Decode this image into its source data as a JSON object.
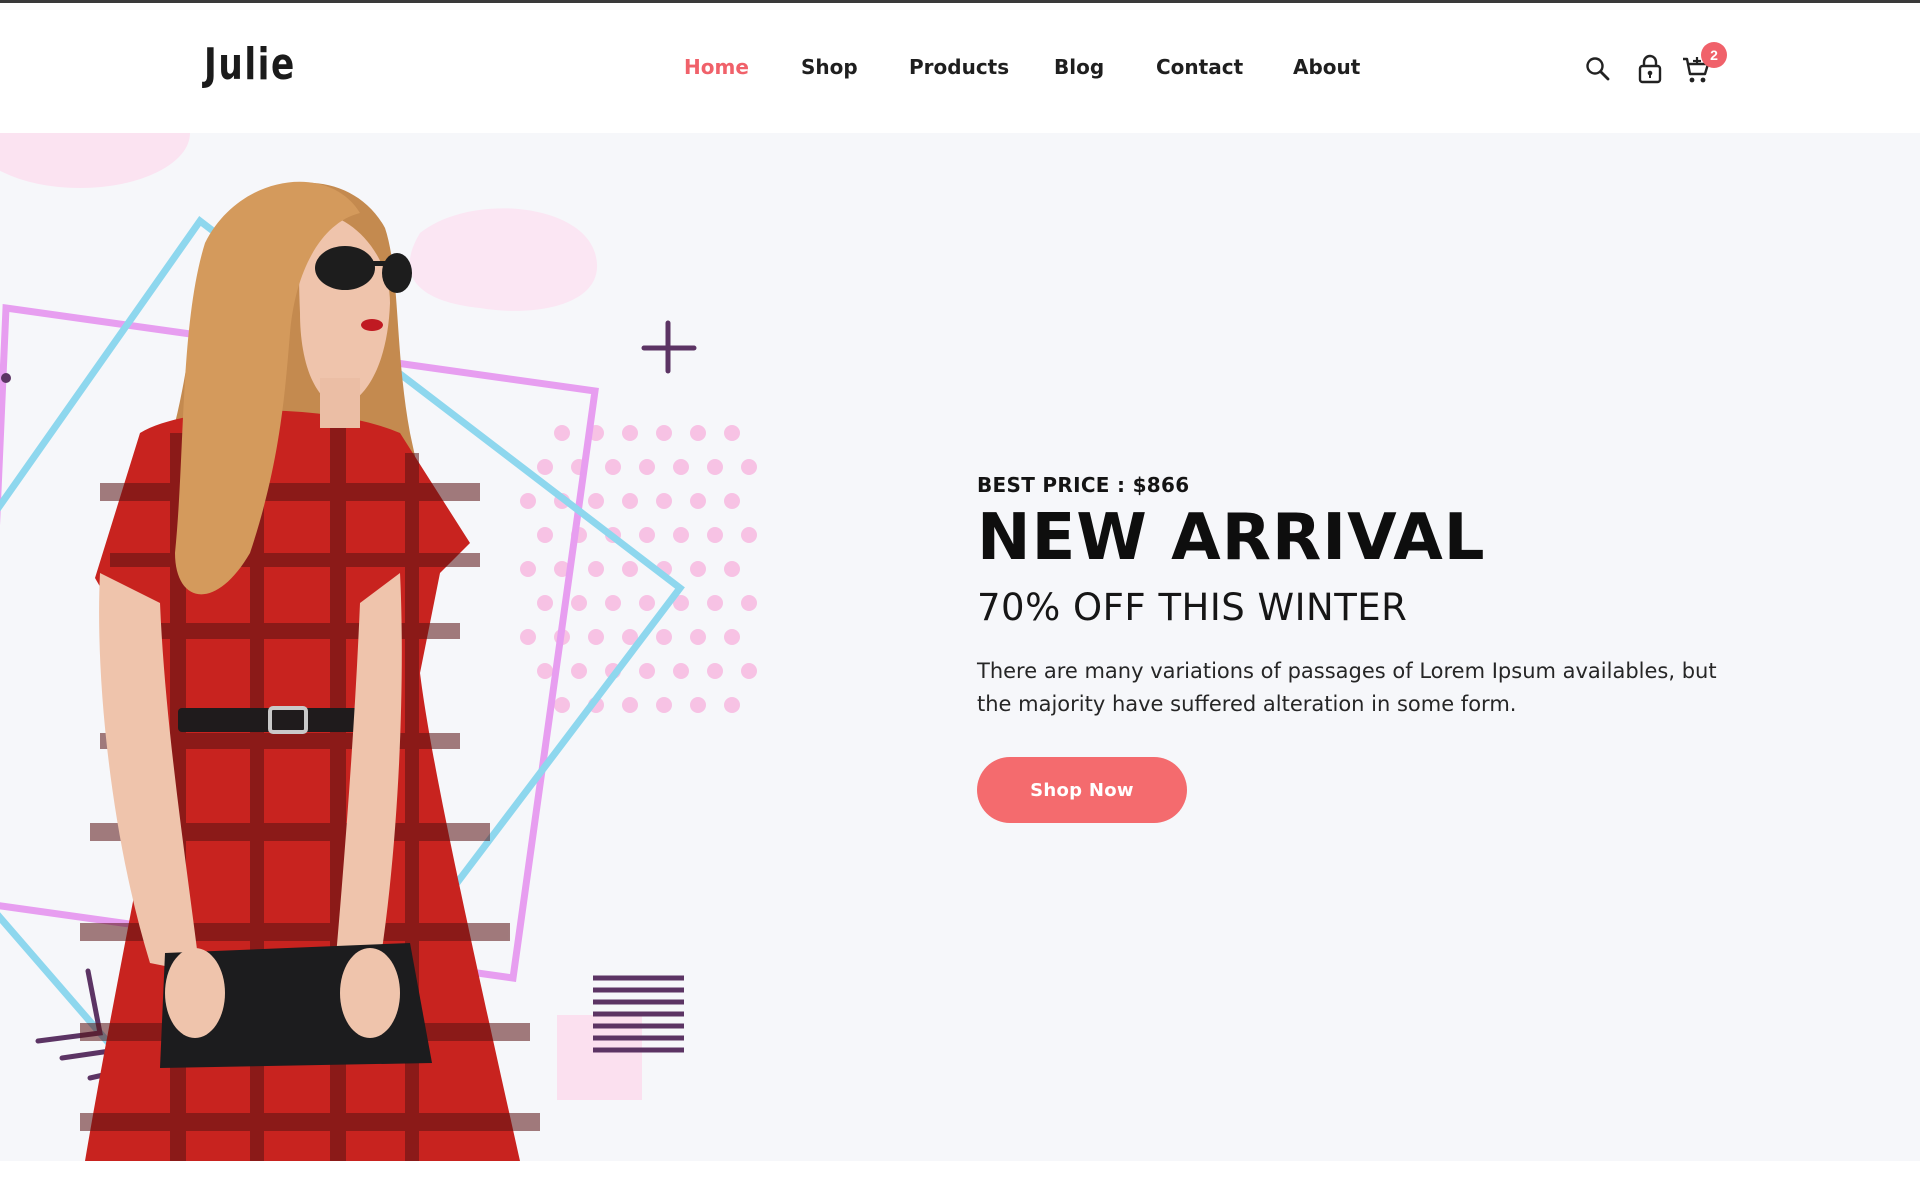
{
  "brand": {
    "logo": "Julie"
  },
  "nav": {
    "items": [
      {
        "label": "Home",
        "active": true
      },
      {
        "label": "Shop"
      },
      {
        "label": "Products"
      },
      {
        "label": "Blog"
      },
      {
        "label": "Contact"
      },
      {
        "label": "About"
      }
    ]
  },
  "header_icons": {
    "search": "search-icon",
    "account": "lock-icon",
    "cart": "cart-icon",
    "cart_count": "2"
  },
  "hero": {
    "best_price": "BEST PRICE : $866",
    "title": "NEW ARRIVAL",
    "subtitle": "70% OFF THIS WINTER",
    "description": "There are many variations of passages of Lorem Ipsum availables, but the majority have suffered alteration in some form.",
    "cta_label": "Shop Now"
  },
  "colors": {
    "accent": "#f0616a",
    "button": "#f46b6e",
    "hero_bg": "#f6f7fa",
    "text_dark": "#0e0e0e"
  }
}
